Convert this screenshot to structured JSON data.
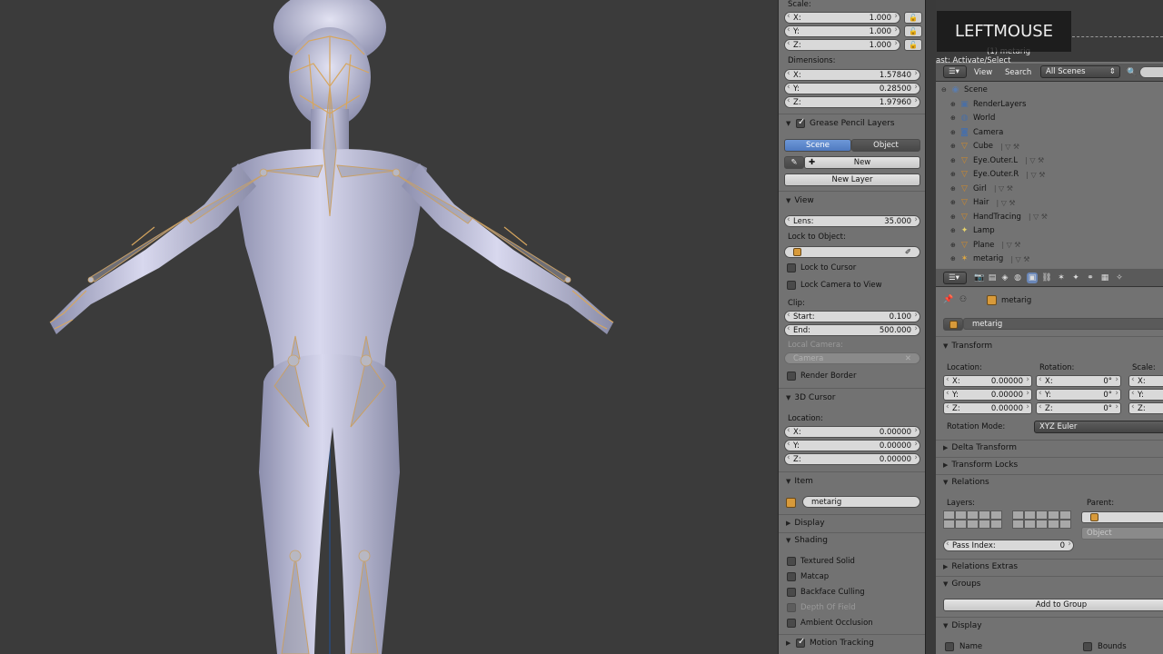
{
  "viewport": {
    "overlay_text": "LEFTMOUSE",
    "status_object": "(1) metarig",
    "status_operator": "ast: Activate/Select"
  },
  "npanel": {
    "scale_label": "Scale:",
    "scale": [
      {
        "k": "X:",
        "v": "1.000"
      },
      {
        "k": "Y:",
        "v": "1.000"
      },
      {
        "k": "Z:",
        "v": "1.000"
      }
    ],
    "dimensions_label": "Dimensions:",
    "dimensions": [
      {
        "k": "X:",
        "v": "1.57840"
      },
      {
        "k": "Y:",
        "v": "0.28500"
      },
      {
        "k": "Z:",
        "v": "1.97960"
      }
    ],
    "grease_pencil": {
      "title": "Grease Pencil Layers",
      "tab_scene": "Scene",
      "tab_object": "Object",
      "new_label": "New",
      "new_layer_label": "New Layer"
    },
    "view": {
      "title": "View",
      "lens_k": "Lens:",
      "lens_v": "35.000",
      "lock_to_object": "Lock to Object:",
      "lock_to_cursor": "Lock to Cursor",
      "lock_camera": "Lock Camera to View",
      "clip": "Clip:",
      "start_k": "Start:",
      "start_v": "0.100",
      "end_k": "End:",
      "end_v": "500.000",
      "local_camera": "Local Camera:",
      "camera": "Camera",
      "render_border": "Render Border"
    },
    "cursor": {
      "title": "3D Cursor",
      "location": "Location:",
      "values": [
        {
          "k": "X:",
          "v": "0.00000"
        },
        {
          "k": "Y:",
          "v": "0.00000"
        },
        {
          "k": "Z:",
          "v": "0.00000"
        }
      ]
    },
    "item": {
      "title": "Item",
      "name": "metarig"
    },
    "display_title": "Display",
    "shading": {
      "title": "Shading",
      "textured_solid": "Textured Solid",
      "matcap": "Matcap",
      "backface": "Backface Culling",
      "depth_of_field": "Depth Of Field",
      "ambient_occlusion": "Ambient Occlusion"
    },
    "motion_tracking": "Motion Tracking"
  },
  "outliner": {
    "menu_view": "View",
    "menu_search": "Search",
    "scenes_select": "All Scenes",
    "scene": "Scene",
    "items": [
      {
        "name": "RenderLayers",
        "icon": "render-layers-icon",
        "glyph": "▣"
      },
      {
        "name": "World",
        "icon": "world-icon",
        "glyph": "◍"
      },
      {
        "name": "Camera",
        "icon": "camera-icon",
        "glyph": "◙"
      },
      {
        "name": "Cube",
        "icon": "mesh-icon",
        "glyph": "▽"
      },
      {
        "name": "Eye.Outer.L",
        "icon": "mesh-icon",
        "glyph": "▽"
      },
      {
        "name": "Eye.Outer.R",
        "icon": "mesh-icon",
        "glyph": "▽"
      },
      {
        "name": "Girl",
        "icon": "mesh-icon",
        "glyph": "▽"
      },
      {
        "name": "Hair",
        "icon": "mesh-icon",
        "glyph": "▽"
      },
      {
        "name": "HandTracing",
        "icon": "mesh-icon",
        "glyph": "▽"
      },
      {
        "name": "Lamp",
        "icon": "lamp-icon",
        "glyph": "✦"
      },
      {
        "name": "Plane",
        "icon": "mesh-icon",
        "glyph": "▽"
      },
      {
        "name": "metarig",
        "icon": "armature-icon",
        "glyph": "✶"
      }
    ]
  },
  "properties": {
    "breadcrumb": "metarig",
    "object_name": "metarig",
    "transform": {
      "title": "Transform",
      "location": "Location:",
      "rotation": "Rotation:",
      "scale": "Scale:",
      "loc": [
        {
          "k": "X:",
          "v": "0.00000"
        },
        {
          "k": "Y:",
          "v": "0.00000"
        },
        {
          "k": "Z:",
          "v": "0.00000"
        }
      ],
      "rot": [
        {
          "k": "X:",
          "v": "0°"
        },
        {
          "k": "Y:",
          "v": "0°"
        },
        {
          "k": "Z:",
          "v": "0°"
        }
      ],
      "scl": [
        {
          "k": "X:"
        },
        {
          "k": "Y:"
        },
        {
          "k": "Z:"
        }
      ],
      "rotation_mode_label": "Rotation Mode:",
      "rotation_mode": "XYZ Euler"
    },
    "delta_transform": "Delta Transform",
    "transform_locks": "Transform Locks",
    "relations": {
      "title": "Relations",
      "layers": "Layers:",
      "parent": "Parent:",
      "parent_type": "Object",
      "pass_index_k": "Pass Index:",
      "pass_index_v": "0"
    },
    "relations_extras": "Relations Extras",
    "groups": {
      "title": "Groups",
      "add": "Add to Group"
    },
    "display": {
      "title": "Display",
      "name": "Name",
      "bounds": "Bounds"
    }
  }
}
